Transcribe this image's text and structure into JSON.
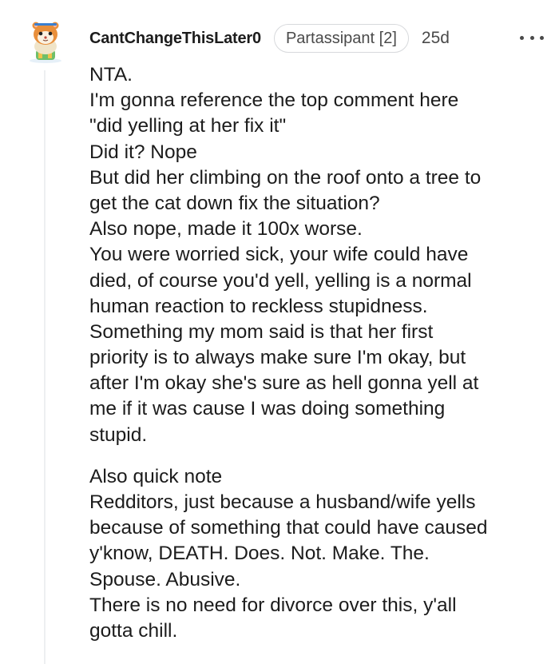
{
  "comment": {
    "username": "CantChangeThisLater0",
    "flair": "Partassipant [2]",
    "time": "25d",
    "avatar_icon": "hamster-avatar-icon",
    "more_icon": "more-options-icon",
    "paragraphs": [
      [
        "NTA.",
        "I'm gonna reference the top comment here",
        "\"did yelling at her fix it\"",
        "Did it? Nope",
        "But did her climbing on the roof onto a tree to",
        "get the cat down fix the situation?",
        "Also nope, made it 100x worse.",
        "You were worried sick, your wife could have",
        "died, of course you'd yell, yelling is a normal",
        "human reaction to reckless stupidness.",
        "Something my mom said is that her first",
        "priority is to always make sure I'm okay, but",
        "after I'm okay she's sure as hell gonna yell at",
        "me if it was cause I was doing something",
        "stupid."
      ],
      [
        "Also quick note",
        "Redditors, just because a husband/wife yells",
        "because of something that could have caused",
        "y'know, DEATH. Does. Not. Make. The.",
        "Spouse. Abusive.",
        "There is no need for divorce over this, y'all",
        "gotta chill."
      ]
    ]
  },
  "colors": {
    "text": "#1c1c1c",
    "meta": "#4a4a4a",
    "flair_border": "#d7d9dc",
    "thread_line": "#edeff1"
  }
}
